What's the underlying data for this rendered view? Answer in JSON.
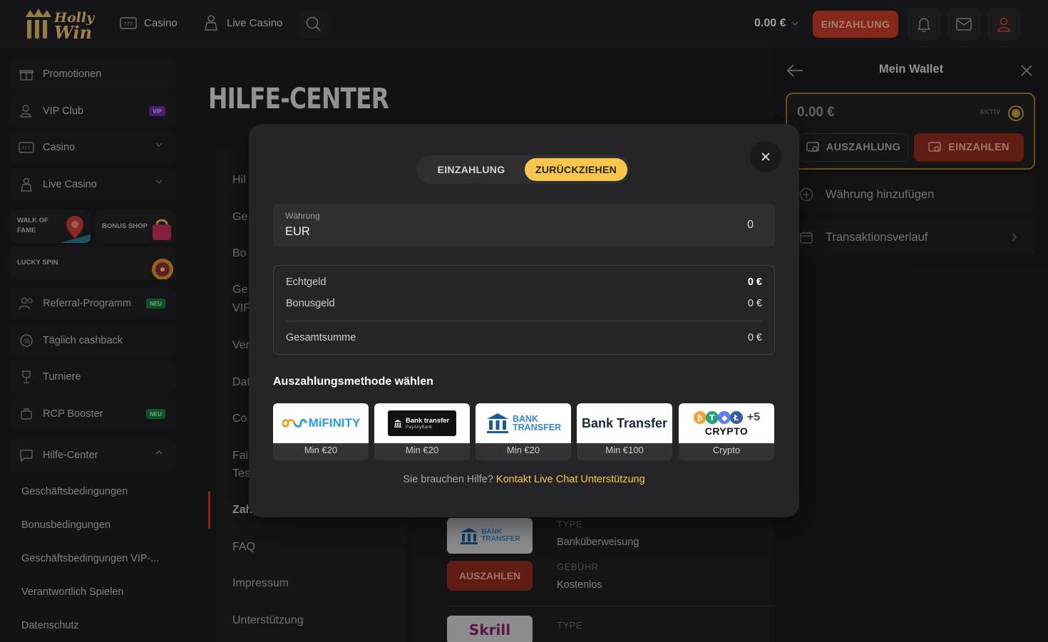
{
  "header": {
    "brand_line1": "Holly",
    "brand_line2": "Win",
    "nav": [
      {
        "label": "Casino",
        "icon": "slot-machine-icon"
      },
      {
        "label": "Live Casino",
        "icon": "dealer-icon"
      }
    ],
    "balance": "0.00 €",
    "deposit_label": "EINZAHLUNG"
  },
  "sidebar": {
    "items": [
      {
        "label": "Promotionen",
        "icon": "gift-icon"
      },
      {
        "label": "VIP Club",
        "icon": "user-icon",
        "badge": "VIP"
      },
      {
        "label": "Casino",
        "icon": "slot-machine-icon"
      },
      {
        "label": "Live Casino",
        "icon": "dealer-icon"
      }
    ],
    "tiles": {
      "walk_of_fame": "WALK OF FAME",
      "bonus_shop": "BONUS SHOP",
      "lucky_spin": "LUCKY SPIN"
    },
    "items2": [
      {
        "label": "Referral-Programm",
        "icon": "users-icon",
        "badge": "NEU"
      },
      {
        "label": "Täglich cashback",
        "icon": "cashback-icon"
      },
      {
        "label": "Turniere",
        "icon": "trophy-icon"
      },
      {
        "label": "RCP Booster",
        "icon": "booster-icon",
        "badge": "NEU"
      },
      {
        "label": "Hilfe-Center",
        "icon": "chat-icon"
      }
    ],
    "sub_items": [
      "Geschäftsbedingungen",
      "Bonusbedingungen",
      "Geschäftsbedingungen VIP-...",
      "Verantwortlich Spielen",
      "Datenschutz"
    ]
  },
  "main": {
    "title": "HILFE-CENTER",
    "links": [
      "Hil",
      "Ge",
      "Bo",
      "Ge",
      "VIF",
      "Ver",
      "Dat",
      "Co",
      "Fai",
      "Tes",
      "Zah",
      "FAQ",
      "Impressum",
      "Unterstützung"
    ],
    "bank_logo_line1": "BANK",
    "bank_logo_line2": "TRANSFER",
    "type_label": "TYPE",
    "type_value": "Banküberweisung",
    "fee_label": "GEBÜHR",
    "fee_value": "Kostenlos",
    "payout_label": "AUSZAHLEN",
    "skrill_logo": "Skrill",
    "type_label2": "TYPE"
  },
  "wallet": {
    "title": "Mein Wallet",
    "amount": "0.00 €",
    "aktiv": "AKTIV",
    "payout_label": "AUSZAHLUNG",
    "deposit_label": "EINZAHLEN",
    "add_currency": "Währung hinzufügen",
    "history": "Transaktionsverlauf"
  },
  "modal": {
    "tabs": {
      "deposit": "EINZAHLUNG",
      "withdraw": "ZURÜCKZIEHEN"
    },
    "currency_label": "Währung",
    "currency_value": "EUR",
    "currency_amount": "0",
    "rows": [
      {
        "label": "Echtgeld",
        "value": "0 €"
      },
      {
        "label": "Bonusgeld",
        "value": "0 €"
      },
      {
        "label": "Gesamtsumme",
        "value": "0 €"
      }
    ],
    "methods_title": "Auszahlungsmethode wählen",
    "methods": [
      {
        "name": "MiFINITY",
        "min": "Min €20"
      },
      {
        "name": "Bank transfer",
        "sub": "PayAnyBank",
        "min": "Min €20"
      },
      {
        "name": "BANK",
        "name2": "TRANSFER",
        "min": "Min €20"
      },
      {
        "name": "Bank Transfer",
        "min": "Min €100"
      },
      {
        "name": "CRYPTO",
        "extra": "+5",
        "min": "Crypto"
      }
    ],
    "help_text": "Sie brauchen Hilfe?",
    "help_link": "Kontakt Live Chat Unterstützung"
  },
  "colors": {
    "accent_red": "#c43a26",
    "accent_yellow": "#f7c64e",
    "wallet_gold": "#9c7a2a"
  }
}
